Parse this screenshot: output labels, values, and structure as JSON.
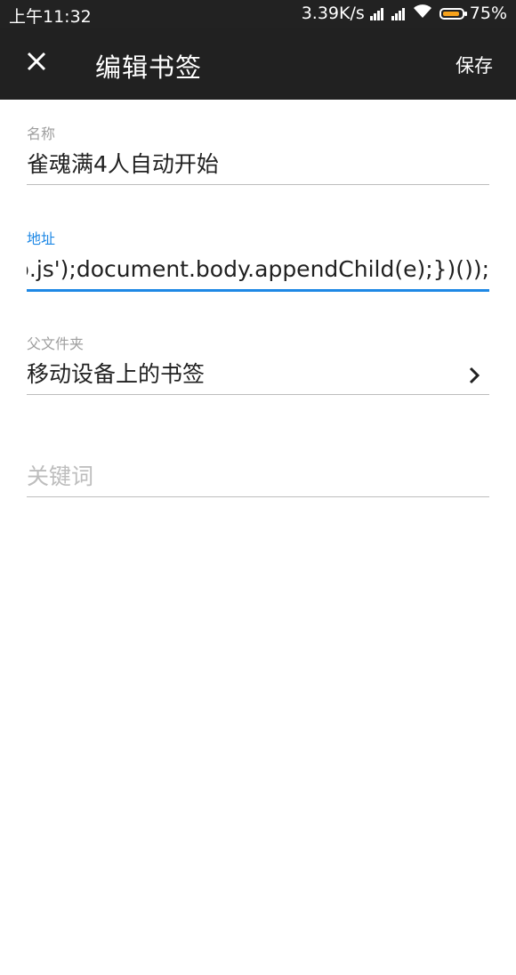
{
  "status_bar": {
    "time": "上午11:32",
    "network_speed": "3.39K/s",
    "battery_percent": "75%",
    "battery_level": 0.75,
    "battery_color": "#f7a21b"
  },
  "toolbar": {
    "title": "编辑书签",
    "save_label": "保存",
    "close_icon": "close-icon"
  },
  "form": {
    "name": {
      "label": "名称",
      "value": "雀魂满4人自动开始"
    },
    "url": {
      "label": "地址",
      "value": "oop.js');document.body.appendChild(e);})());"
    },
    "parent_folder": {
      "label": "父文件夹",
      "value": "移动设备上的书签"
    },
    "keywords": {
      "placeholder": "关键词"
    }
  },
  "colors": {
    "accent": "#1e88e5",
    "toolbar": "#212121"
  }
}
